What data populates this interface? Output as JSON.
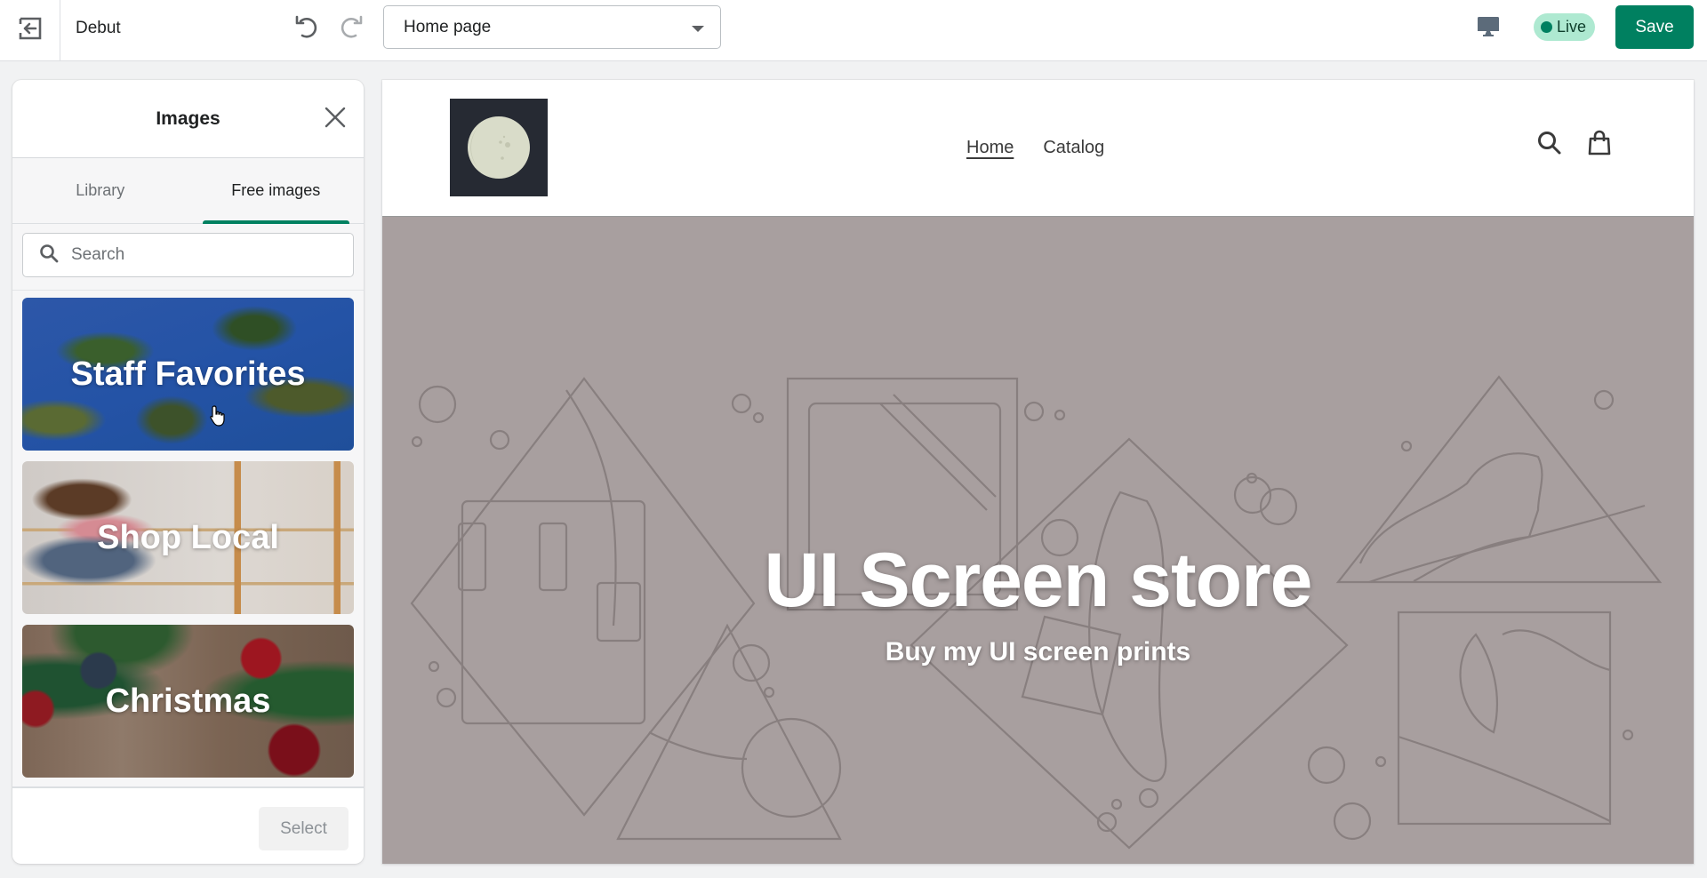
{
  "topbar": {
    "exit_icon": "exit-arrow-icon",
    "theme_name": "Debut",
    "undo_icon": "undo-icon",
    "redo_icon": "redo-icon",
    "page_select": {
      "value": "Home page"
    },
    "device_icon": "desktop-icon",
    "status_badge": "Live",
    "save_label": "Save"
  },
  "panel": {
    "title": "Images",
    "close_icon": "close-icon",
    "tabs": [
      {
        "label": "Library",
        "active": false
      },
      {
        "label": "Free images",
        "active": true
      }
    ],
    "search": {
      "placeholder": "Search",
      "value": ""
    },
    "collections": [
      {
        "label": "Staff Favorites"
      },
      {
        "label": "Shop Local"
      },
      {
        "label": "Christmas"
      }
    ],
    "select_label": "Select"
  },
  "store": {
    "nav": [
      {
        "label": "Home",
        "current": true
      },
      {
        "label": "Catalog",
        "current": false
      }
    ],
    "icons": [
      "search-icon",
      "shopping-bag-icon"
    ],
    "hero": {
      "title": "UI Screen store",
      "subtitle": "Buy my UI screen prints"
    }
  },
  "colors": {
    "brand": "#008060",
    "badge_bg": "#aee9d1",
    "hero_bg": "#a89f9f",
    "logo_bg": "#262a33"
  }
}
